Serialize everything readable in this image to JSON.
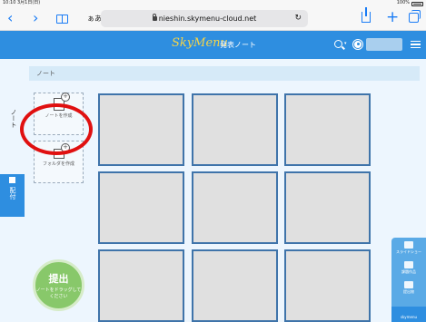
{
  "status_bar": {
    "time_date": "10:10 3月1日(日)",
    "battery": "100%"
  },
  "browser": {
    "text_size_button": "ぁあ",
    "url": "nieshin.skymenu-cloud.net",
    "back": "‹",
    "forward": "›",
    "new_tab": "+",
    "reload": "↻"
  },
  "app_header": {
    "logo_main": "SkyMenu",
    "title": "発表ノート",
    "search_caret": "▾"
  },
  "left_rail": {
    "note_label": "ノート",
    "distribute_label": "配付"
  },
  "breadcrumb": "ノート",
  "tools": {
    "create_note": "ノートを作成",
    "create_folder": "フォルダを作成"
  },
  "submit": {
    "title": "提出",
    "hint": "ノートをドラッグしてください"
  },
  "right_rail": {
    "slideshow": "スライドショー",
    "works": "課題作品",
    "materials": "提出物",
    "bottom": "skymenu"
  },
  "notes": [
    "",
    "",
    "",
    "",
    "",
    "",
    "",
    "",
    ""
  ]
}
